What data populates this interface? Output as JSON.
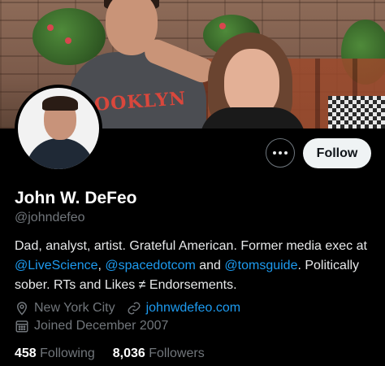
{
  "profile": {
    "name": "John W. DeFeo",
    "handle": "@johndefeo",
    "bio": {
      "line1": "Dad, analyst, artist. Grateful American. Former media exec at",
      "mention1": "@LiveScience",
      "sep1": ", ",
      "mention2": "@spacedotcom",
      "and": " and ",
      "mention3": "@tomsguide",
      "line2_tail": ". Politically",
      "line3": "sober. RTs and Likes ≠ Endorsements."
    },
    "location": "New York City",
    "website": "johnwdefeo.com",
    "joined": "Joined December 2007",
    "following_count": "458",
    "following_label": "Following",
    "followers_count": "8,036",
    "followers_label": "Followers"
  },
  "banner": {
    "shirt_text": "OOKLYN"
  },
  "actions": {
    "follow_label": "Follow",
    "more_icon": "more-horizontal-icon"
  },
  "colors": {
    "accent": "#1d9bf0",
    "background": "#000000",
    "secondary_text": "#71767b"
  }
}
